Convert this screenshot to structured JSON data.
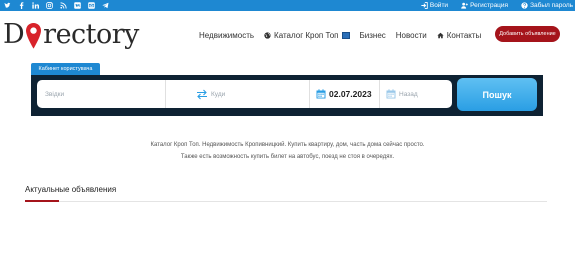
{
  "topbar": {
    "social_icons": [
      "twitter-icon",
      "facebook-icon",
      "linkedin-icon",
      "instagram-icon",
      "rss-icon",
      "vk-icon",
      "mail-icon",
      "telegram-icon"
    ],
    "login": "Войти",
    "register": "Регистрация",
    "forgot": "Забыл пароль"
  },
  "logo": {
    "left": "D",
    "right": "rectory"
  },
  "nav": {
    "items": [
      "Недвижимость",
      "Каталог Кроп Топ",
      "Бизнес",
      "Новости",
      "Контакты"
    ],
    "post_button": "Добавить объявление"
  },
  "search": {
    "tab": "Кабинет користувача",
    "from_placeholder": "Звідки",
    "to_placeholder": "Куди",
    "date": "02.07.2023",
    "back_placeholder": "Назад",
    "button": "Пошук"
  },
  "description": {
    "line1": "Каталог Кроп Топ. Недвижимость Кропивницкий. Купить квартиру, дом, часть дома сейчас просто.",
    "line2": "Также есть возможность купить билет на автобус, поезд не стоя в очередях."
  },
  "section": {
    "title": "Актуальные объявления"
  },
  "colors": {
    "topbar": "#1e88d2",
    "accent": "#a5141b",
    "panel": "#0e2233",
    "button": "#2a9ee4",
    "pin": "#d8232a"
  }
}
